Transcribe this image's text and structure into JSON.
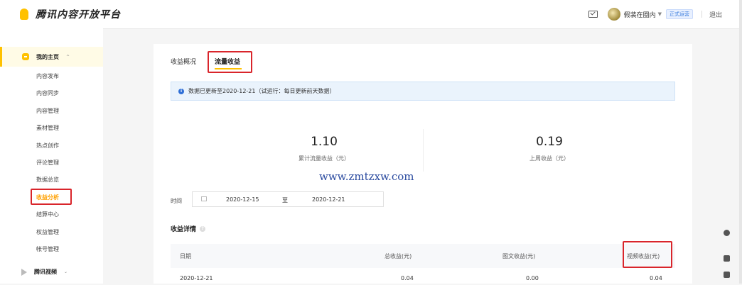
{
  "header": {
    "logo_text": "腾讯内容开放平台",
    "username": "假装在圈内",
    "badge": "正式运营",
    "logout": "退出"
  },
  "sidebar": {
    "home": {
      "label": "我的主页",
      "expand": "^"
    },
    "items": [
      {
        "label": "内容发布"
      },
      {
        "label": "内容同步"
      },
      {
        "label": "内容管理"
      },
      {
        "label": "素材管理"
      },
      {
        "label": "热点创作"
      },
      {
        "label": "评论管理"
      },
      {
        "label": "数据总览"
      },
      {
        "label": "收益分析"
      },
      {
        "label": "结算中心"
      },
      {
        "label": "权益管理"
      },
      {
        "label": "帐号管理"
      }
    ],
    "video": {
      "label": "腾讯视频",
      "expand": "⌄"
    }
  },
  "main": {
    "tabs": [
      {
        "label": "收益概况"
      },
      {
        "label": "流量收益"
      }
    ],
    "notice": "数据已更新至2020-12-21（试运行：每日更新前天数据）",
    "stats": [
      {
        "value": "1.10",
        "label": "累计流量收益（元）"
      },
      {
        "value": "0.19",
        "label": "上周收益（元）"
      }
    ],
    "watermark": "www.zmtzxw.com",
    "time_label": "时间",
    "date_start": "2020-12-15",
    "date_to": "至",
    "date_end": "2020-12-21",
    "detail_title": "收益详情",
    "table": {
      "headers": [
        "日期",
        "总收益(元)",
        "图文收益(元)",
        "视频收益(元)"
      ],
      "rows": [
        [
          "2020-12-21",
          "0.04",
          "0.00",
          "0.04"
        ]
      ]
    }
  },
  "colors": {
    "accent": "#ffc100",
    "highlight_box": "#d9252b",
    "active_text": "#ffa000"
  }
}
